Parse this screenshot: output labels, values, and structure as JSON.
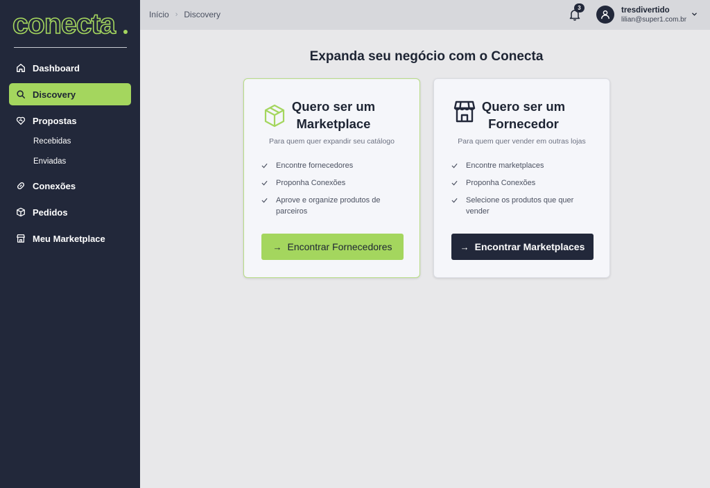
{
  "brand": {
    "logo_text": "conecta",
    "accent_color": "#a4d65e",
    "sidebar_color": "#22283a"
  },
  "sidebar": {
    "items": [
      {
        "label": "Dashboard",
        "icon": "home-icon"
      },
      {
        "label": "Discovery",
        "icon": "search-icon",
        "active": true
      },
      {
        "label": "Propostas",
        "icon": "heart-handshake-icon"
      },
      {
        "label": "Conexões",
        "icon": "link-icon"
      },
      {
        "label": "Pedidos",
        "icon": "box-icon"
      },
      {
        "label": "Meu Marketplace",
        "icon": "store-icon"
      }
    ],
    "sub_items": [
      "Recebidas",
      "Enviadas"
    ]
  },
  "topbar": {
    "breadcrumb": [
      "Início",
      "Discovery"
    ],
    "notification_count": "3",
    "user_name": "tresdivertido",
    "user_email": "lilian@super1.com.br"
  },
  "main": {
    "headline": "Expanda seu negócio com o Conecta",
    "cards": [
      {
        "title_line1": "Quero ser um",
        "title_line2": "Marketplace",
        "subtitle": "Para quem quer expandir seu catálogo",
        "features": [
          "Encontre fornecedores",
          "Proponha Conexões",
          "Aprove e organize produtos de parceiros"
        ],
        "button": "Encontrar Fornecedores",
        "icon": "package-icon"
      },
      {
        "title_line1": "Quero ser um",
        "title_line2": "Fornecedor",
        "subtitle": "Para quem quer vender em outras lojas",
        "features": [
          "Encontre marketplaces",
          "Proponha Conexões",
          "Selecione os produtos que quer vender"
        ],
        "button": "Encontrar Marketplaces",
        "icon": "storefront-icon"
      }
    ]
  }
}
